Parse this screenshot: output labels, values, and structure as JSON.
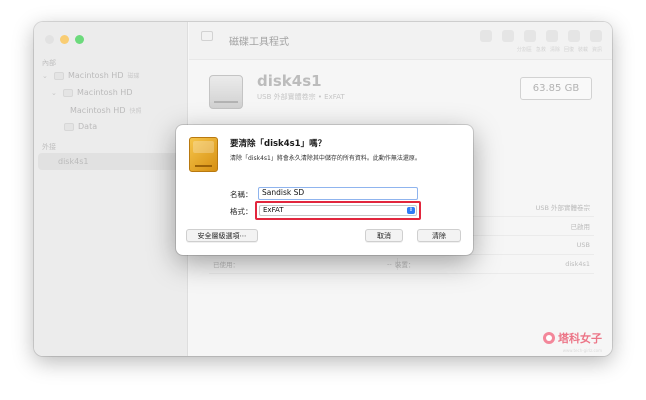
{
  "window": {
    "traffic_colors": {
      "close": "#d4d4d4",
      "minimize": "#f6b532",
      "zoom": "#27c93f"
    }
  },
  "sidebar": {
    "section_internal": "內部",
    "section_external": "外接",
    "items": [
      {
        "label": "Macintosh HD",
        "tag": "磁碟"
      },
      {
        "label": "Macintosh HD"
      },
      {
        "label": "Macintosh HD",
        "tag": "快照"
      },
      {
        "label": "Data"
      },
      {
        "label": "disk4s1"
      }
    ]
  },
  "toolbar": {
    "title": "磁碟工具程式",
    "icon_labels": [
      "分割區",
      "急救",
      "清除",
      "回復",
      "裝載",
      "資訊"
    ]
  },
  "volume": {
    "name": "disk4s1",
    "subtitle": "USB 外部實體卷宗 • ExFAT",
    "capacity": "63.85 GB"
  },
  "info_rows": [
    {
      "value": "USB 外部實體卷宗"
    },
    {
      "value": "已啟用"
    },
    {
      "value": "USB"
    },
    {
      "label": "已使用：",
      "mid": "--",
      "label2": "裝置：",
      "value": "disk4s1"
    }
  ],
  "dialog": {
    "title": "要清除「disk4s1」嗎？",
    "message": "清除「disk4s1」將會永久清除其中儲存的所有資料。此動作無法還原。",
    "name_label": "名稱：",
    "name_value": "Sandisk SD",
    "format_label": "格式：",
    "format_value": "ExFAT",
    "security_button": "安全層級選項⋯",
    "cancel_button": "取消",
    "erase_button": "清除",
    "highlight_color": "#e2263d"
  },
  "watermark": {
    "text": "塔科女子",
    "url": "www.tech-girlz.com"
  }
}
